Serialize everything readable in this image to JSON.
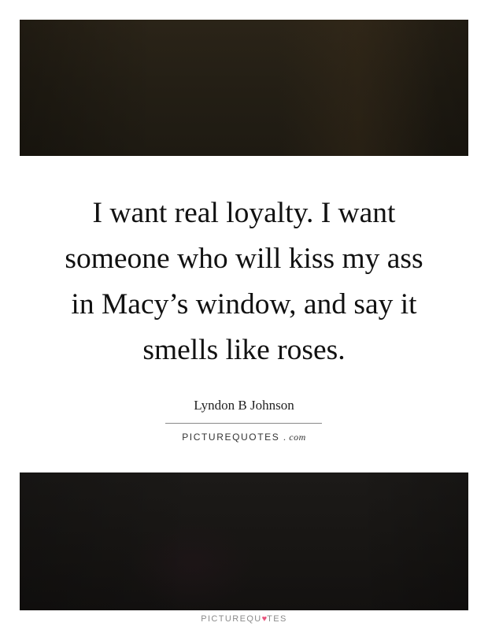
{
  "quote": {
    "lines": [
      "I want real loyalty. I want",
      "someone who will kiss my ass",
      "in Macy’s window, and say it",
      "smells like roses."
    ],
    "author": "Lyndon B Johnson"
  },
  "branding": {
    "site_name": "PICTUREQUOTES",
    "site_tld": ". com",
    "footer_prefix": "PICTUREQU",
    "footer_suffix": "TES",
    "heart_color": "#e8557d"
  }
}
